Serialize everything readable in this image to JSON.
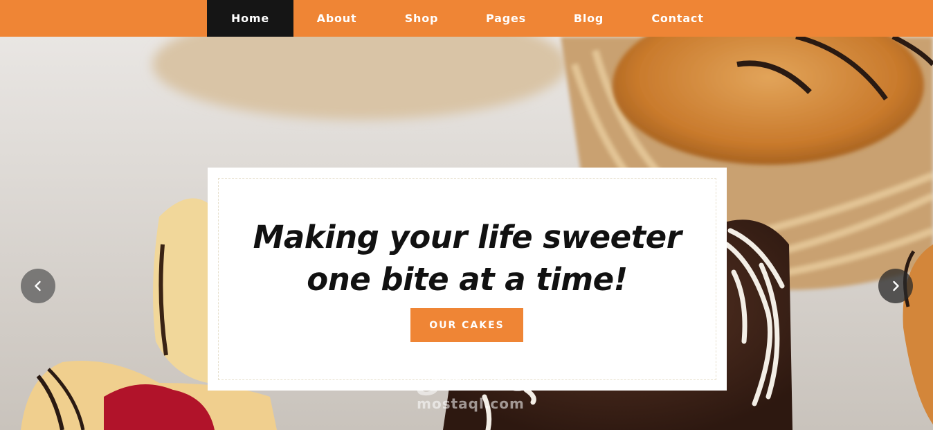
{
  "nav": {
    "items": [
      {
        "label": "Home",
        "active": true
      },
      {
        "label": "About",
        "active": false
      },
      {
        "label": "Shop",
        "active": false
      },
      {
        "label": "Pages",
        "active": false
      },
      {
        "label": "Blog",
        "active": false
      },
      {
        "label": "Contact",
        "active": false
      }
    ]
  },
  "hero": {
    "headline_line1": "Making your life sweeter",
    "headline_line2": "one bite at a time!",
    "cta_label": "OUR CAKES"
  },
  "slider": {
    "prev_icon": "chevron-left-icon",
    "next_icon": "chevron-right-icon"
  },
  "watermark": {
    "arabic": "مستقل",
    "latin": "mostaql.com"
  },
  "colors": {
    "accent": "#ef8535",
    "nav_active": "#151515",
    "text_dark": "#111111"
  }
}
